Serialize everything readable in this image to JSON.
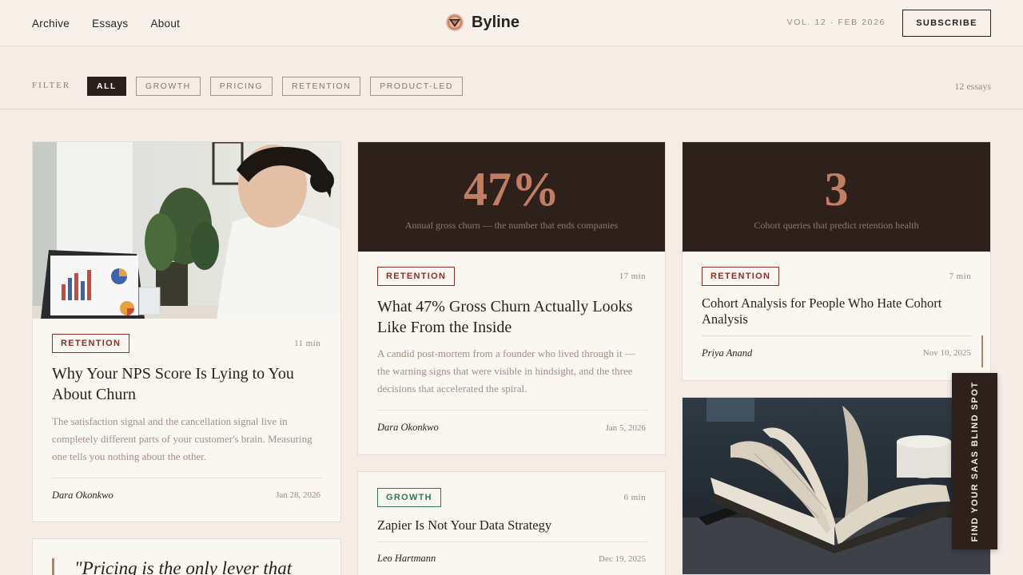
{
  "nav": {
    "items": [
      "Archive",
      "Essays",
      "About"
    ]
  },
  "brand": {
    "name": "Byline",
    "logo": "byline-logo-icon",
    "accent": "#c27e63"
  },
  "header": {
    "issue": "VOL. 12 · FEB 2026",
    "subscribe_label": "SUBSCRIBE"
  },
  "filter": {
    "label": "FILTER",
    "chips": [
      "ALL",
      "GROWTH",
      "PRICING",
      "RETENTION",
      "PRODUCT-LED"
    ],
    "active": "ALL",
    "count": "12 essays"
  },
  "cards": [
    {
      "image": "woman-working-laptop-photo",
      "tag": "RETENTION",
      "minutes": "11 min",
      "title": "Why Your NPS Score Is Lying to You About Churn",
      "excerpt": "The satisfaction signal and the cancellation signal live in completely different parts of your customer's brain. Measuring one tells you nothing about the other.",
      "author": "Dara Okonkwo",
      "date": "Jan 28, 2026"
    },
    {
      "stat": "47%",
      "stat_caption": "Annual gross churn — the number that ends companies",
      "tag": "RETENTION",
      "minutes": "17 min",
      "title": "What 47% Gross Churn Actually Looks Like From the Inside",
      "excerpt": "A candid post-mortem from a founder who lived through it — the warning signs that were visible in hindsight, and the three decisions that accelerated the spiral.",
      "author": "Dara Okonkwo",
      "date": "Jan 5, 2026"
    },
    {
      "stat": "3",
      "stat_caption": "Cohort queries that predict retention health",
      "tag": "RETENTION",
      "minutes": "7 min",
      "title": "Cohort Analysis for People Who Hate Cohort Analysis",
      "author": "Priya Anand",
      "date": "Nov 10, 2025"
    },
    {
      "tag": "GROWTH",
      "minutes": "6 min",
      "title": "Zapier Is Not Your Data Strategy",
      "author": "Leo Hartmann",
      "date": "Dec 19, 2025"
    },
    {
      "image": "open-book-photo"
    },
    {
      "quote": "\"Pricing is the only lever that"
    }
  ],
  "side_tab": {
    "label": "FIND YOUR SAAS BLIND SPOT"
  },
  "colors": {
    "dark": "#2e201a",
    "retention": "#8b2e26",
    "growth": "#2f7a47",
    "background": "#f4ece5"
  }
}
